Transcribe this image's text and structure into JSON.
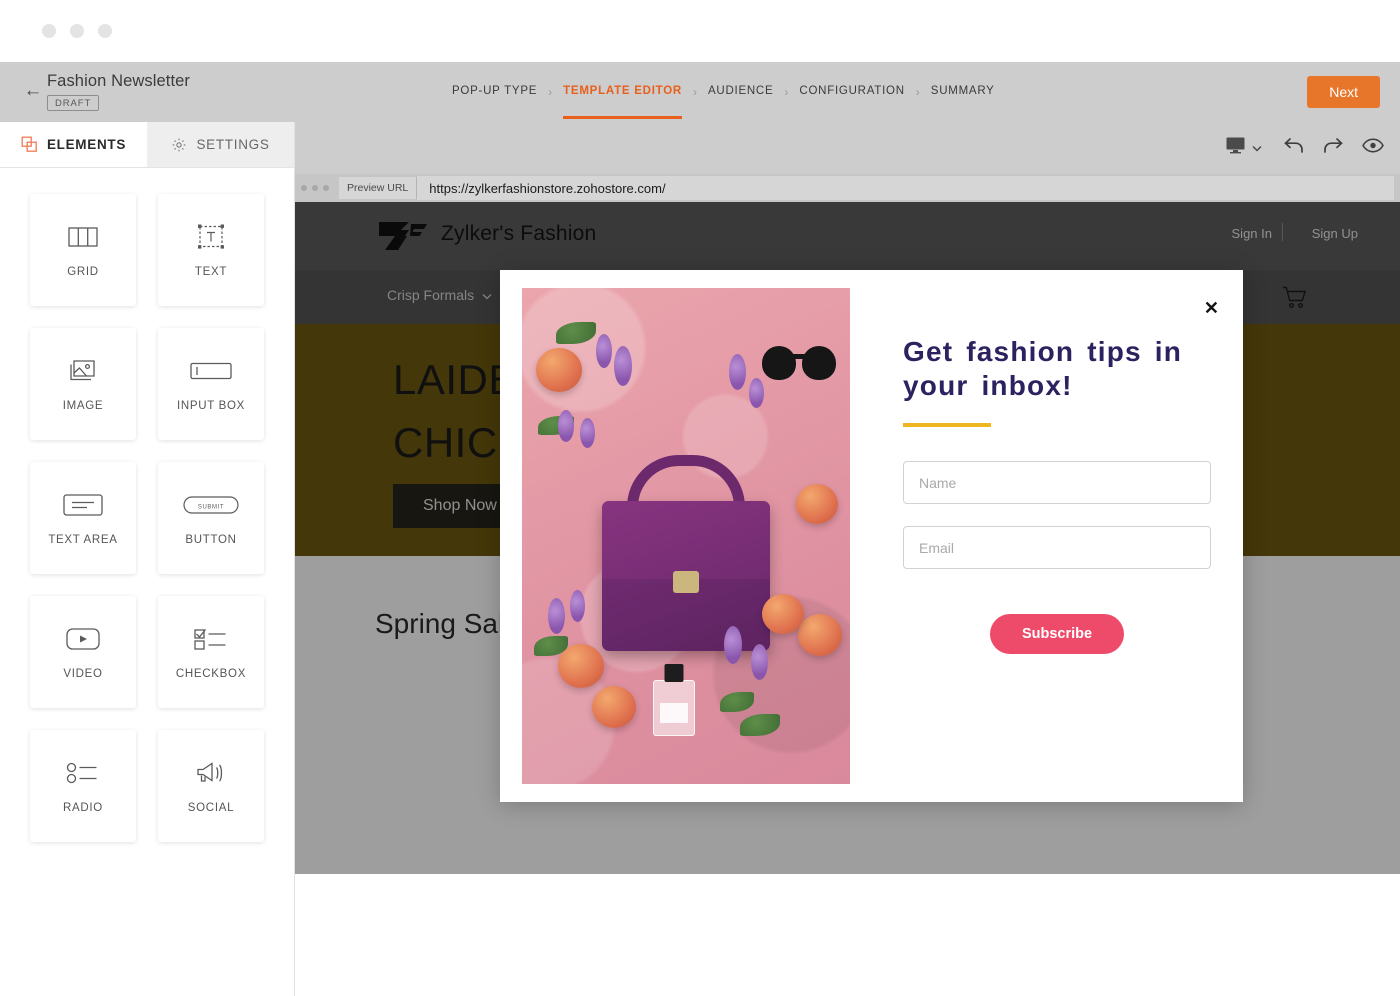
{
  "window": {
    "dots": 3
  },
  "header": {
    "back_icon": "back-arrow-icon",
    "title": "Fashion Newsletter",
    "status_badge": "DRAFT",
    "next_label": "Next",
    "steps": [
      {
        "label": "POP-UP TYPE",
        "active": false
      },
      {
        "label": "TEMPLATE EDITOR",
        "active": true
      },
      {
        "label": "AUDIENCE",
        "active": false
      },
      {
        "label": "CONFIGURATION",
        "active": false
      },
      {
        "label": "SUMMARY",
        "active": false
      }
    ],
    "step_separator": "›",
    "accent_color": "#e8601c"
  },
  "left_panel": {
    "tabs": [
      {
        "label": "ELEMENTS",
        "icon": "layers-icon",
        "active": true
      },
      {
        "label": "SETTINGS",
        "icon": "gear-icon",
        "active": false
      }
    ],
    "elements": [
      {
        "label": "GRID",
        "icon": "grid-icon"
      },
      {
        "label": "TEXT",
        "icon": "text-icon"
      },
      {
        "label": "IMAGE",
        "icon": "image-icon"
      },
      {
        "label": "INPUT BOX",
        "icon": "input-box-icon"
      },
      {
        "label": "TEXT AREA",
        "icon": "text-area-icon"
      },
      {
        "label": "BUTTON",
        "icon": "button-icon",
        "glyph_label": "SUBMIT"
      },
      {
        "label": "VIDEO",
        "icon": "video-icon"
      },
      {
        "label": "CHECKBOX",
        "icon": "checkbox-icon"
      },
      {
        "label": "RADIO",
        "icon": "radio-icon"
      },
      {
        "label": "SOCIAL",
        "icon": "social-megaphone-icon"
      }
    ]
  },
  "canvas_toolbar": {
    "device_icon": "desktop-monitor-icon",
    "device_dropdown_icon": "chevron-down-icon",
    "undo_icon": "undo-arrow-icon",
    "redo_icon": "redo-arrow-icon",
    "preview_icon": "eye-icon"
  },
  "preview_bar": {
    "label": "Preview URL",
    "url": "https://zylkerfashionstore.zohostore.com/"
  },
  "site": {
    "brand": "Zylker's Fashion",
    "logo_icon": "zf-monogram-icon",
    "sign_in": "Sign In",
    "sign_up": "Sign Up",
    "nav_item": "Crisp Formals",
    "nav_caret_icon": "chevron-down-icon",
    "cart_icon": "shopping-cart-icon",
    "hero_line1": "LAIDBACK",
    "hero_line2": "CHIC",
    "hero_cta": "Shop Now",
    "hero_bg": "#6e5a10",
    "section_title": "Spring Sale"
  },
  "popup": {
    "close_icon": "close-x-icon",
    "title": "Get fashion tips in your inbox!",
    "image_alt": "purple handbag flat lay with peaches lavender sunglasses and perfume on pink fabric",
    "rule_color": "#f0b622",
    "title_color": "#2b2260",
    "fields": [
      {
        "name": "name",
        "placeholder": "Name",
        "value": ""
      },
      {
        "name": "email",
        "placeholder": "Email",
        "value": ""
      }
    ],
    "submit_label": "Subscribe",
    "submit_color": "#ee4b6a"
  }
}
